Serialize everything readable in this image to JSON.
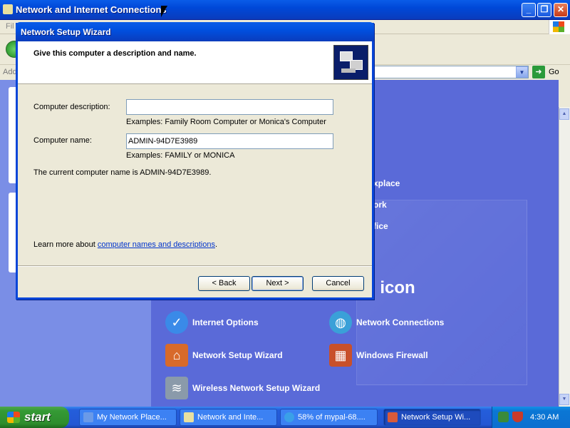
{
  "background_window": {
    "title": "Network and Internet Connections",
    "menu_first": "Fil",
    "address_label": "Add",
    "go_label": "Go",
    "partial_links": [
      "xplace",
      "ork",
      "fice"
    ],
    "partial_heading": "l icon",
    "control_panel_items": [
      {
        "label": "Internet Options",
        "icon": "internet-options-icon",
        "color": "#3a8ae8"
      },
      {
        "label": "Network Connections",
        "icon": "network-connections-icon",
        "color": "#3aa0d8"
      },
      {
        "label": "Network Setup Wizard",
        "icon": "network-setup-wizard-icon",
        "color": "#d86a2a"
      },
      {
        "label": "Windows Firewall",
        "icon": "windows-firewall-icon",
        "color": "#c8502a"
      },
      {
        "label": "Wireless Network Setup Wizard",
        "icon": "wireless-network-setup-wizard-icon",
        "color": "#8a9aaa"
      }
    ]
  },
  "dialog": {
    "title": "Network Setup Wizard",
    "header": "Give this computer a description and name.",
    "description_label": "Computer description:",
    "description_value": "",
    "description_hint": "Examples: Family Room Computer or Monica's Computer",
    "name_label": "Computer name:",
    "name_value": "ADMIN-94D7E3989",
    "name_hint": "Examples: FAMILY or MONICA",
    "current_name_text": "The current computer name is ADMIN-94D7E3989.",
    "learn_more_prefix": "Learn more about ",
    "learn_more_link": "computer names and descriptions",
    "learn_more_suffix": ".",
    "buttons": {
      "back": "< Back",
      "next": "Next >",
      "cancel": "Cancel"
    }
  },
  "taskbar": {
    "start_label": "start",
    "tasks": [
      {
        "label": "My Network Place...",
        "active": false
      },
      {
        "label": "Network and Inte...",
        "active": false
      },
      {
        "label": "58% of mypal-68....",
        "active": false
      },
      {
        "label": "Network Setup Wi...",
        "active": true
      }
    ],
    "clock": "4:30 AM"
  },
  "colors": {
    "title_bar": "#0a5ce8",
    "taskbar": "#245edb",
    "start_button": "#359a35",
    "panel_background": "#5a6ad8",
    "dialog_face": "#ece9d8"
  }
}
